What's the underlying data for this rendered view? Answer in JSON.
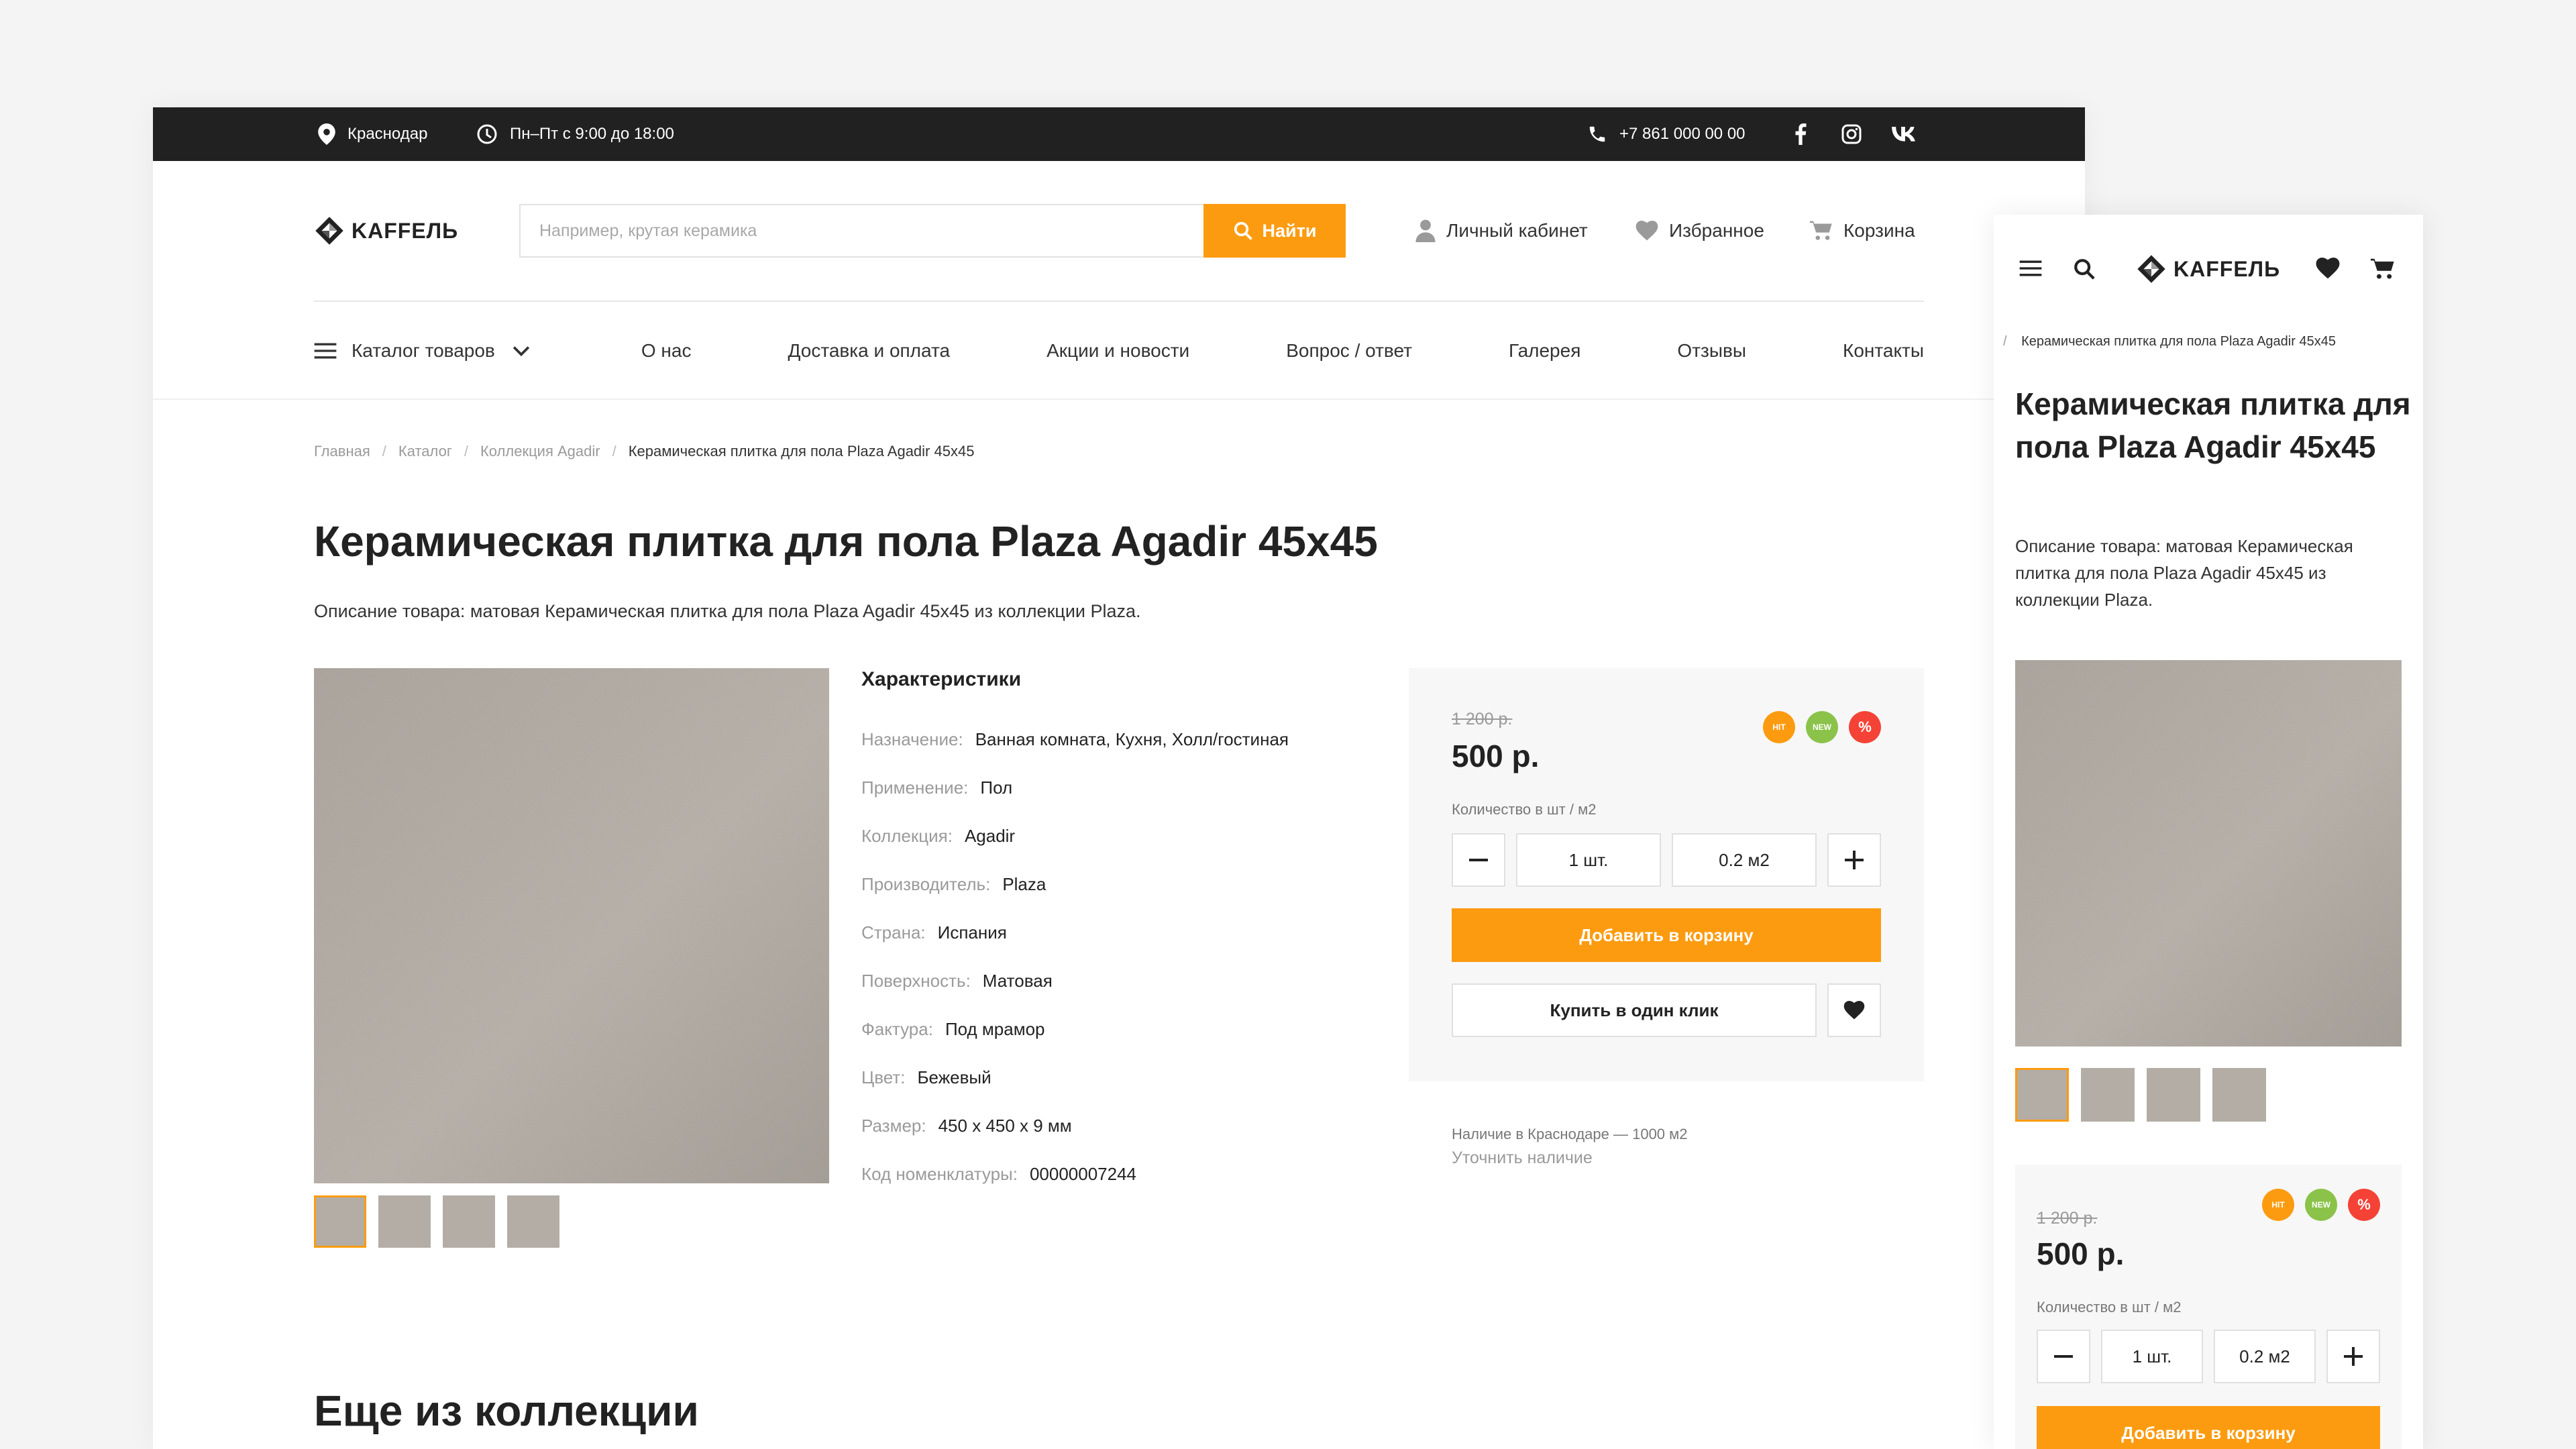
{
  "colors": {
    "accent": "#fd9b10",
    "topbar": "#212121",
    "hit": "#fd9b10",
    "new": "#8bc34a",
    "sale": "#f44336"
  },
  "topbar": {
    "city": "Краснодар",
    "hours": "Пн–Пт с 9:00 до 18:00",
    "phone": "+7 861 000 00 00",
    "social_icons": [
      "facebook-icon",
      "instagram-icon",
      "vk-icon"
    ]
  },
  "logo": "KAFFEЛЬ",
  "search": {
    "placeholder": "Например, крутая керамика",
    "button": "Найти"
  },
  "header_links": {
    "account": "Личный кабинет",
    "favorites": "Избранное",
    "cart": "Корзина"
  },
  "nav": {
    "catalog": "Каталог товаров",
    "items": [
      "О нас",
      "Доставка и оплата",
      "Акции и новости",
      "Вопрос / ответ",
      "Галерея",
      "Отзывы",
      "Контакты"
    ]
  },
  "breadcrumbs": [
    "Главная",
    "Каталог",
    "Коллекция Agadir",
    "Керамическая плитка для пола Plaza Agadir 45x45"
  ],
  "product": {
    "title": "Керамическая плитка для пола Plaza Agadir 45x45",
    "description": "Описание товара: матовая Керамическая плитка для пола Plaza Agadir 45x45 из коллекции Plaza.",
    "characteristics_title": "Характеристики",
    "characteristics": [
      {
        "k": "Назначение:",
        "v": "Ванная комната, Кухня, Холл/гостиная"
      },
      {
        "k": "Применение:",
        "v": "Пол"
      },
      {
        "k": "Коллекция:",
        "v": "Agadir"
      },
      {
        "k": "Производитель:",
        "v": "Plaza"
      },
      {
        "k": "Страна:",
        "v": "Испания"
      },
      {
        "k": "Поверхность:",
        "v": "Матовая"
      },
      {
        "k": "Фактура:",
        "v": "Под мрамор"
      },
      {
        "k": "Цвет:",
        "v": "Бежевый"
      },
      {
        "k": "Размер:",
        "v": "450 x 450 x 9 мм"
      },
      {
        "k": "Код номенклатуры:",
        "v": "00000007244"
      }
    ],
    "old_price": "1 200 р.",
    "price": "500 р.",
    "badges": [
      "HIT",
      "NEW",
      "%"
    ],
    "qty_label": "Количество в шт / м2",
    "qty_pcs": "1 шт.",
    "qty_m2": "0.2 м2",
    "add_to_cart": "Добавить в корзину",
    "buy_one_click": "Купить в один клик",
    "availability": "Наличие в Краснодаре — 1000 м2",
    "check_availability": "Уточнить наличие"
  },
  "more_from_collection": "Еще из коллекции"
}
